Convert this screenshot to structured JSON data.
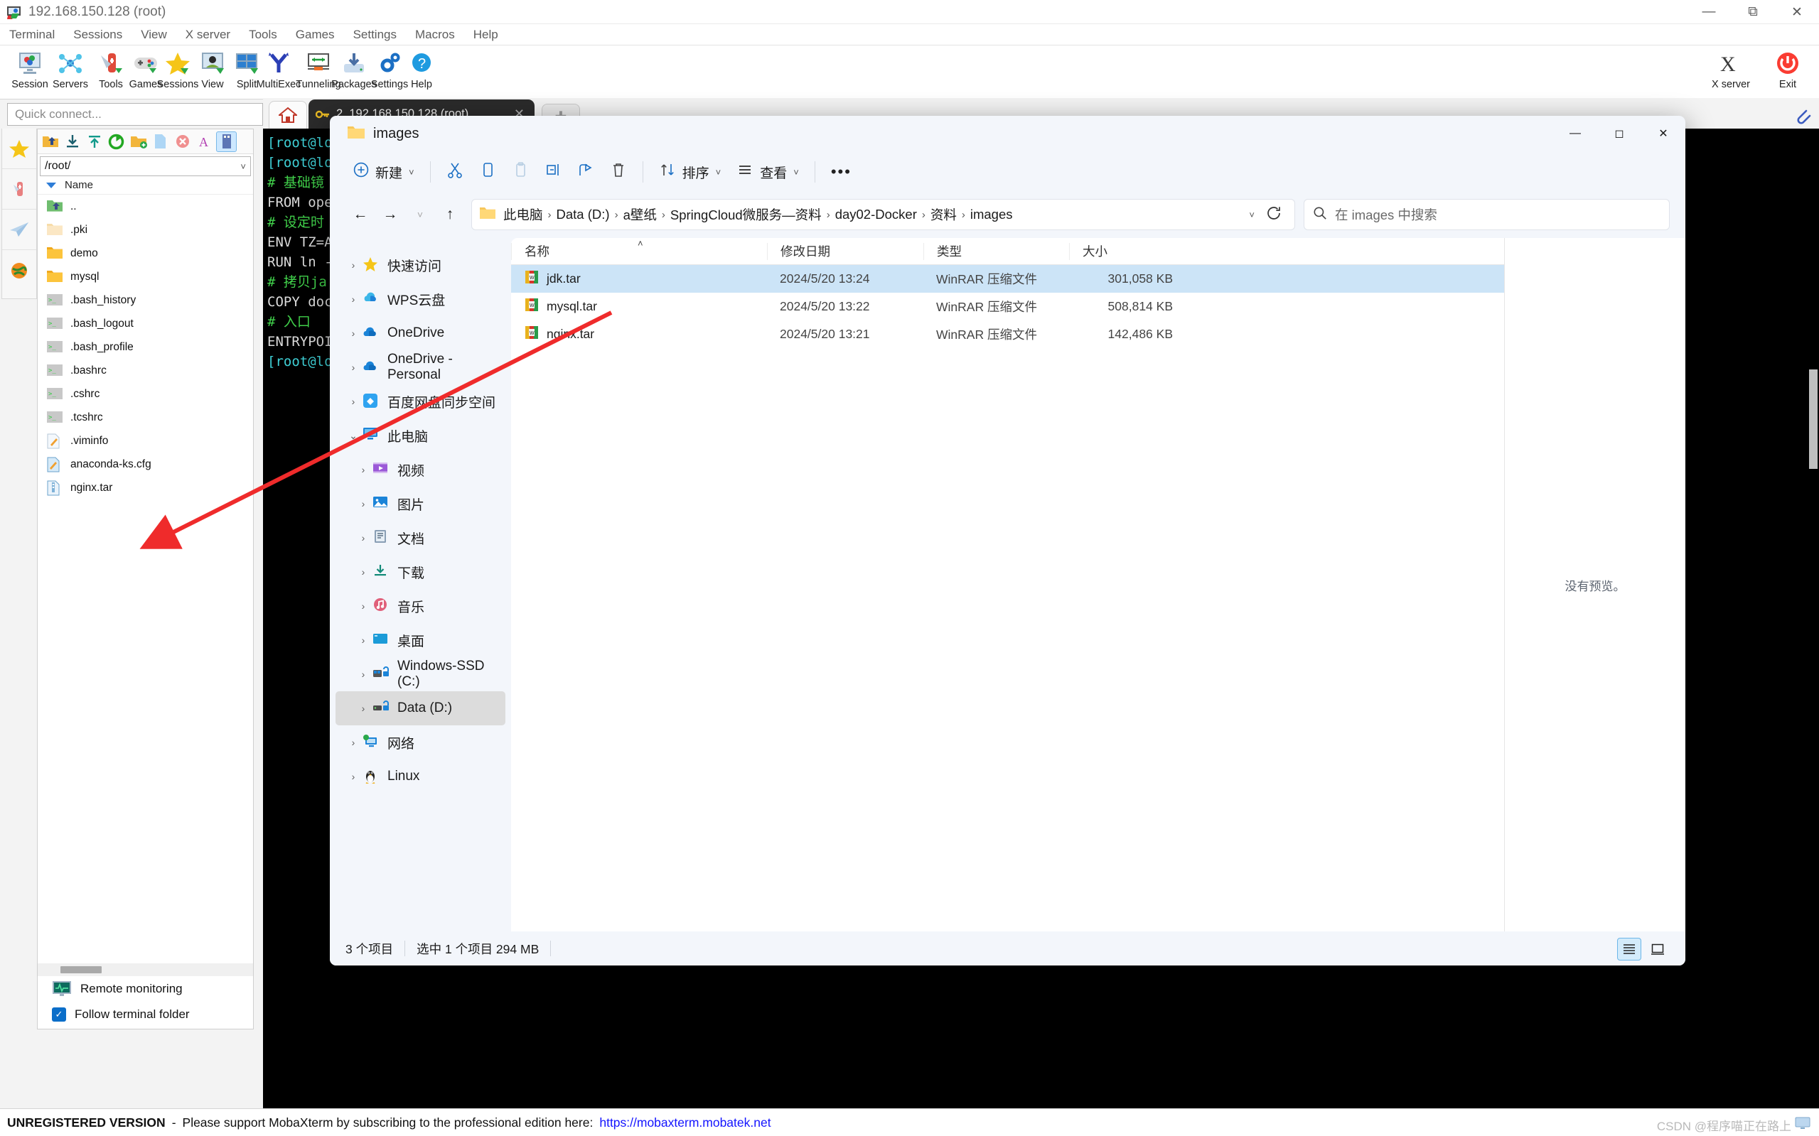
{
  "app": {
    "title": "192.168.150.128 (root)",
    "menu": [
      "Terminal",
      "Sessions",
      "View",
      "X server",
      "Tools",
      "Games",
      "Settings",
      "Macros",
      "Help"
    ],
    "toolbar": [
      {
        "label": "Session",
        "icon": "session-icon"
      },
      {
        "label": "Servers",
        "icon": "servers-icon"
      },
      {
        "label": "Tools",
        "icon": "tools-icon"
      },
      {
        "label": "Games",
        "icon": "games-icon"
      },
      {
        "label": "Sessions",
        "icon": "sessions-star-icon"
      },
      {
        "label": "View",
        "icon": "view-icon"
      },
      {
        "label": "Split",
        "icon": "split-icon"
      },
      {
        "label": "MultiExec",
        "icon": "multiexec-icon"
      },
      {
        "label": "Tunneling",
        "icon": "tunneling-icon"
      },
      {
        "label": "Packages",
        "icon": "packages-icon"
      },
      {
        "label": "Settings",
        "icon": "settings-gear-icon"
      },
      {
        "label": "Help",
        "icon": "help-icon"
      }
    ],
    "toolbar_right": [
      {
        "label": "X server",
        "icon": "xserver-icon"
      },
      {
        "label": "Exit",
        "icon": "exit-power-icon"
      }
    ],
    "quick_connect_placeholder": "Quick connect...",
    "tabs": {
      "home_label": "",
      "session_label": "2. 192.168.150.128 (root)",
      "new_tab_label": "+"
    },
    "banner": {
      "unregistered": "UNREGISTERED VERSION",
      "dash": "-",
      "message": "Please support MobaXterm by subscribing to the professional edition here:",
      "link": "https://mobaxterm.mobatek.net"
    },
    "watermark": "CSDN @程序喵正在路上"
  },
  "sftp": {
    "path": "/root/",
    "column_header": "Name",
    "items": [
      {
        "name": "..",
        "icon": "up-folder-icon"
      },
      {
        "name": ".pki",
        "icon": "folder-icon-light"
      },
      {
        "name": "demo",
        "icon": "folder-icon"
      },
      {
        "name": "mysql",
        "icon": "folder-icon"
      },
      {
        "name": ".bash_history",
        "icon": "script-file-icon"
      },
      {
        "name": ".bash_logout",
        "icon": "script-file-icon"
      },
      {
        "name": ".bash_profile",
        "icon": "script-file-icon"
      },
      {
        "name": ".bashrc",
        "icon": "script-file-icon"
      },
      {
        "name": ".cshrc",
        "icon": "script-file-icon"
      },
      {
        "name": ".tcshrc",
        "icon": "script-file-icon"
      },
      {
        "name": ".viminfo",
        "icon": "text-file-icon"
      },
      {
        "name": "anaconda-ks.cfg",
        "icon": "config-file-icon"
      },
      {
        "name": "nginx.tar",
        "icon": "archive-file-icon"
      }
    ],
    "remote_monitoring": "Remote monitoring",
    "follow_terminal_folder": "Follow terminal folder"
  },
  "terminal": {
    "lines": [
      {
        "parts": [
          {
            "t": "[root@lo",
            "c": "cy"
          }
        ]
      },
      {
        "parts": [
          {
            "t": "[root@lo",
            "c": "cy"
          }
        ]
      },
      {
        "parts": [
          {
            "t": "# 基础镜",
            "c": "gr"
          }
        ]
      },
      {
        "parts": [
          {
            "t": "FROM ope",
            "c": "wh"
          }
        ]
      },
      {
        "parts": [
          {
            "t": "# 设定时",
            "c": "gr"
          }
        ]
      },
      {
        "parts": [
          {
            "t": "ENV TZ=A",
            "c": "wh"
          }
        ]
      },
      {
        "parts": [
          {
            "t": "RUN ln -",
            "c": "wh"
          }
        ]
      },
      {
        "parts": [
          {
            "t": "# 拷贝ja",
            "c": "gr"
          }
        ]
      },
      {
        "parts": [
          {
            "t": "COPY doc",
            "c": "wh"
          }
        ]
      },
      {
        "parts": [
          {
            "t": "# 入口",
            "c": "gr"
          }
        ]
      },
      {
        "parts": [
          {
            "t": "ENTRYPOI",
            "c": "wh"
          }
        ]
      },
      {
        "parts": [
          {
            "t": "[root@lo",
            "c": "cy"
          }
        ]
      }
    ]
  },
  "explorer": {
    "window_title": "images",
    "toolbar": {
      "new_label": "新建",
      "cut_label": "剪切",
      "copy_label": "复制",
      "paste_label": "粘贴",
      "rename_label": "重命名",
      "share_label": "共享",
      "delete_label": "删除",
      "sort_label": "排序",
      "view_label": "查看",
      "more_label": "•••"
    },
    "address": {
      "breadcrumbs": [
        "此电脑",
        "Data (D:)",
        "a壁纸",
        "SpringCloud微服务—资料",
        "day02-Docker",
        "资料",
        "images"
      ],
      "search_placeholder": "在 images 中搜索"
    },
    "nav_tree": [
      {
        "label": "快速访问",
        "icon": "star-icon",
        "expand": "›",
        "level": 0,
        "selected": false
      },
      {
        "label": "WPS云盘",
        "icon": "wps-cloud-icon",
        "expand": "›",
        "level": 0,
        "selected": false
      },
      {
        "label": "OneDrive",
        "icon": "onedrive-icon",
        "expand": "›",
        "level": 0,
        "selected": false
      },
      {
        "label": "OneDrive - Personal",
        "icon": "onedrive-icon",
        "expand": "›",
        "level": 0,
        "selected": false
      },
      {
        "label": "百度网盘同步空间",
        "icon": "baidu-netdisk-icon",
        "expand": "›",
        "level": 0,
        "selected": false
      },
      {
        "label": "此电脑",
        "icon": "this-pc-icon",
        "expand": "⌄",
        "level": 0,
        "selected": false
      },
      {
        "label": "视频",
        "icon": "videos-icon",
        "expand": "›",
        "level": 1,
        "selected": false
      },
      {
        "label": "图片",
        "icon": "pictures-icon",
        "expand": "›",
        "level": 1,
        "selected": false
      },
      {
        "label": "文档",
        "icon": "documents-icon",
        "expand": "›",
        "level": 1,
        "selected": false
      },
      {
        "label": "下载",
        "icon": "downloads-icon",
        "expand": "›",
        "level": 1,
        "selected": false
      },
      {
        "label": "音乐",
        "icon": "music-icon",
        "expand": "›",
        "level": 1,
        "selected": false
      },
      {
        "label": "桌面",
        "icon": "desktop-icon",
        "expand": "›",
        "level": 1,
        "selected": false
      },
      {
        "label": "Windows-SSD (C:)",
        "icon": "drive-windows-icon",
        "expand": "›",
        "level": 1,
        "selected": false
      },
      {
        "label": "Data (D:)",
        "icon": "drive-icon",
        "expand": "›",
        "level": 1,
        "selected": true
      },
      {
        "label": "网络",
        "icon": "network-icon",
        "expand": "›",
        "level": 0,
        "selected": false
      },
      {
        "label": "Linux",
        "icon": "linux-tux-icon",
        "expand": "›",
        "level": 0,
        "selected": false
      }
    ],
    "columns": [
      "名称",
      "修改日期",
      "类型",
      "大小"
    ],
    "files": [
      {
        "name": "jdk.tar",
        "modified": "2024/5/20 13:24",
        "type": "WinRAR 压缩文件",
        "size": "301,058 KB",
        "selected": true
      },
      {
        "name": "mysql.tar",
        "modified": "2024/5/20 13:22",
        "type": "WinRAR 压缩文件",
        "size": "508,814 KB",
        "selected": false
      },
      {
        "name": "nginx.tar",
        "modified": "2024/5/20 13:21",
        "type": "WinRAR 压缩文件",
        "size": "142,486 KB",
        "selected": false
      }
    ],
    "preview_empty": "没有预览。",
    "status": {
      "item_count": "3 个项目",
      "selection": "选中 1 个项目  294 MB"
    }
  },
  "colors": {
    "selection_blue": "#cce4f7",
    "accent_blue": "#0b6ec9",
    "annotation_red": "#ef2b2b",
    "terminal_bg": "#000000"
  }
}
